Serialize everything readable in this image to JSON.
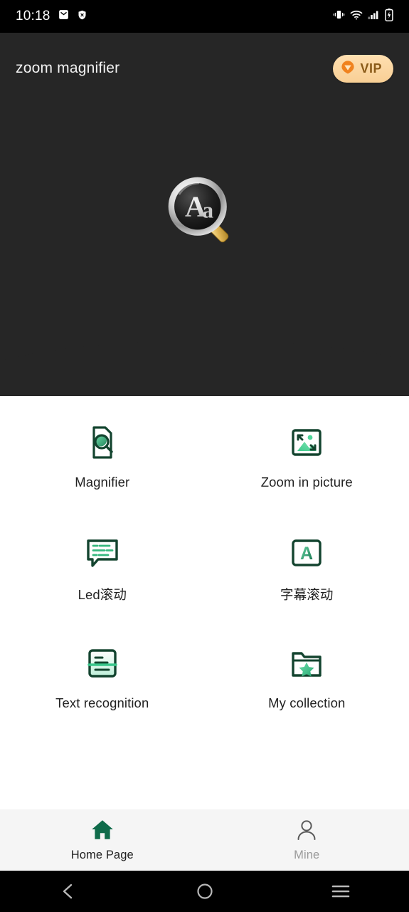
{
  "status_bar": {
    "time": "10:18",
    "left_icons": [
      "mail-icon",
      "shield-icon"
    ],
    "right_icons": [
      "vibrate-icon",
      "wifi-icon",
      "signal-icon",
      "battery-charging-icon"
    ],
    "background_color": "#000000"
  },
  "header": {
    "title": "zoom magnifier",
    "background_color": "#262626",
    "vip_badge": {
      "label": "VIP",
      "icon": "vip-gem-icon",
      "pill_color": "#f8cf95",
      "text_color": "#8a5a18",
      "gem_color": "#f0821e"
    },
    "hero_art": {
      "icon": "magnifier-aa-icon",
      "letters": "Aa",
      "rim_color": "#cfcfcf",
      "handle_color": "#e3b857"
    }
  },
  "grid": {
    "accent_color": "#13442f",
    "gradient_from": "#5fd9a0",
    "gradient_to": "#0f5c3c",
    "items": [
      {
        "label": "Magnifier",
        "icon": "document-magnifier-icon"
      },
      {
        "label": "Zoom in picture",
        "icon": "image-expand-icon"
      },
      {
        "label": "Led滚动",
        "icon": "speech-bubble-text-icon"
      },
      {
        "label": "字幕滚动",
        "icon": "letter-a-box-icon"
      },
      {
        "label": "Text recognition",
        "icon": "text-scan-icon"
      },
      {
        "label": "My collection",
        "icon": "folder-star-icon"
      }
    ]
  },
  "tab_bar": {
    "background_color": "#f5f5f5",
    "active_color": "#0f6b4a",
    "inactive_color": "#9a9a9a",
    "tabs": [
      {
        "label": "Home Page",
        "icon": "home-icon",
        "active": true
      },
      {
        "label": "Mine",
        "icon": "person-icon",
        "active": false
      }
    ]
  },
  "android_nav": {
    "background_color": "#000000",
    "buttons": [
      {
        "name": "back-icon"
      },
      {
        "name": "home-circle-icon"
      },
      {
        "name": "recents-icon"
      }
    ]
  }
}
